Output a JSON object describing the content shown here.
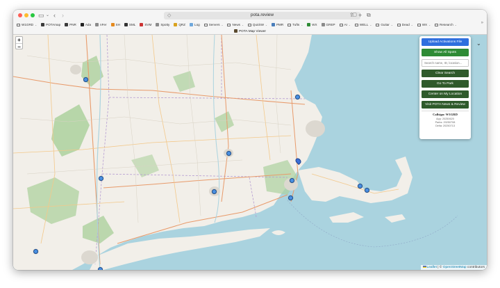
{
  "browser": {
    "url": "pota.review",
    "tab_title": "POTA Map Viewer",
    "bookmarks": [
      {
        "label": "W1GRD",
        "folder": true,
        "color": "#6d6d6d"
      },
      {
        "label": "POTAmap",
        "folder": false,
        "color": "#3b3b3b"
      },
      {
        "label": "PNR",
        "folder": false,
        "color": "#3b3b3b"
      },
      {
        "label": "Ada",
        "folder": false,
        "color": "#222222"
      },
      {
        "label": "nFer",
        "folder": false,
        "color": "#8a8a8a"
      },
      {
        "label": "SH",
        "folder": false,
        "color": "#e58a1f"
      },
      {
        "label": "SML",
        "folder": false,
        "color": "#333333"
      },
      {
        "label": "SVM",
        "folder": false,
        "color": "#cc3333"
      },
      {
        "label": "Spotty",
        "folder": false,
        "color": "#8a8a8a"
      },
      {
        "label": "QRZ",
        "folder": false,
        "color": "#d9a21f"
      },
      {
        "label": "Log",
        "folder": false,
        "color": "#6fa8dc"
      },
      {
        "label": "Servers",
        "folder": true,
        "color": "#6d6d6d"
      },
      {
        "label": "News",
        "folder": true,
        "color": "#6d6d6d"
      },
      {
        "label": "QuickW",
        "folder": true,
        "color": "#6d6d6d"
      },
      {
        "label": "PMR",
        "folder": false,
        "color": "#4a7ebb"
      },
      {
        "label": "Tufts",
        "folder": true,
        "color": "#6d6d6d"
      },
      {
        "label": "WX",
        "folder": false,
        "color": "#2e8b35"
      },
      {
        "label": "GREP",
        "folder": false,
        "color": "#8a8a8a"
      },
      {
        "label": "AI",
        "folder": true,
        "color": "#6d6d6d"
      },
      {
        "label": "WELL",
        "folder": true,
        "color": "#6d6d6d"
      },
      {
        "label": "Guitar",
        "folder": true,
        "color": "#6d6d6d"
      },
      {
        "label": "Dead",
        "folder": true,
        "color": "#6d6d6d"
      },
      {
        "label": "WX",
        "folder": true,
        "color": "#6d6d6d"
      },
      {
        "label": "Research",
        "folder": true,
        "color": "#6d6d6d"
      }
    ]
  },
  "map": {
    "zoom_in": "+",
    "zoom_out": "−",
    "attribution_leaflet": "Leaflet",
    "attribution_sep": " | © ",
    "attribution_osm": "OpenStreetMap",
    "attribution_tail": " contributors",
    "colors": {
      "water": "#aad3df",
      "land": "#f2efe9",
      "forest": "#add19e",
      "marker": "#4a90e2"
    }
  },
  "panel": {
    "upload_label": "Upload Activations File",
    "show_spots_label": "Show All Spots",
    "search_placeholder": "Search name, ID, location...",
    "clear_label": "Clear Search",
    "goto_label": "Go To Park",
    "center_label": "Center on My Location",
    "visit_label": "Visit POTA News & Review",
    "callsign": "Callsign: W1GRD",
    "info_lines": [
      "App: 20250620",
      "Parks: 20250708",
      "Delta: 20250713"
    ]
  },
  "icons": [
    "sidebar-icon",
    "back-icon",
    "forward-icon",
    "shield-icon",
    "share-icon",
    "new-tab-icon",
    "tabs-icon",
    "collapse-icon",
    "marker-icon"
  ]
}
